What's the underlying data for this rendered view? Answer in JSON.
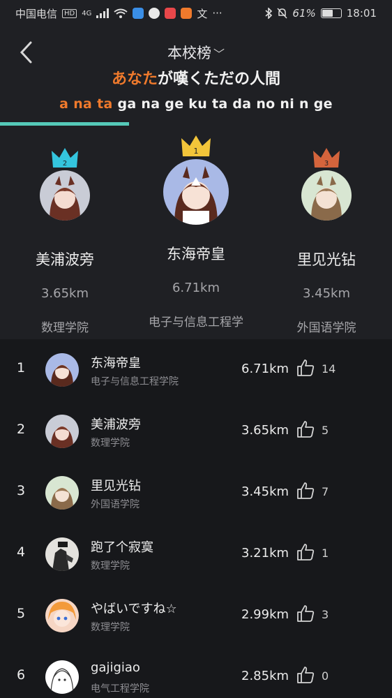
{
  "status_bar": {
    "carrier": "中国电信",
    "hd": "HD",
    "network": "4G",
    "battery_percent": "61%",
    "battery_level": 0.61,
    "time": "18:01",
    "extra_icon_text": "文",
    "more": "···"
  },
  "header": {
    "title": "本校榜",
    "title_chevron": "﹀"
  },
  "lyrics": {
    "line1_highlight": "あなた",
    "line1_rest": "が嘆くただの人間",
    "line2_highlight": "a na ta",
    "line2_rest": " ga na ge ku ta da no ni n ge",
    "progress_fraction": 0.33
  },
  "podium": [
    {
      "rank": "2",
      "name": "美浦波旁",
      "distance": "3.65km",
      "college": "数理学院",
      "crown_color": "#34c5de"
    },
    {
      "rank": "1",
      "name": "东海帝皇",
      "distance": "6.71km",
      "college": "电子与信息工程学",
      "crown_color": "#f3c53a"
    },
    {
      "rank": "3",
      "name": "里见光钻",
      "distance": "3.45km",
      "college": "外国语学院",
      "crown_color": "#d4643c"
    }
  ],
  "rankings": [
    {
      "rank": "1",
      "name": "东海帝皇",
      "college": "电子与信息工程学院",
      "distance": "6.71km",
      "likes": "14"
    },
    {
      "rank": "2",
      "name": "美浦波旁",
      "college": "数理学院",
      "distance": "3.65km",
      "likes": "5"
    },
    {
      "rank": "3",
      "name": "里见光钻",
      "college": "外国语学院",
      "distance": "3.45km",
      "likes": "7"
    },
    {
      "rank": "4",
      "name": "跑了个寂寞",
      "college": "数理学院",
      "distance": "3.21km",
      "likes": "1"
    },
    {
      "rank": "5",
      "name": "やばいですね☆",
      "college": "数理学院",
      "distance": "2.99km",
      "likes": "3"
    },
    {
      "rank": "6",
      "name": "gajigiao",
      "college": "电气工程学院",
      "distance": "2.85km",
      "likes": "0"
    }
  ]
}
